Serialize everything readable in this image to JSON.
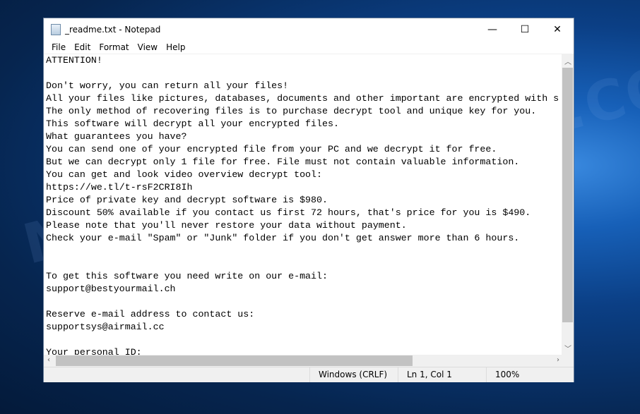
{
  "window": {
    "title": "_readme.txt - Notepad",
    "minimize": "—",
    "maximize": "☐",
    "close": "✕"
  },
  "menu": [
    "File",
    "Edit",
    "Format",
    "View",
    "Help"
  ],
  "text": "ATTENTION!\n\nDon't worry, you can return all your files!\nAll your files like pictures, databases, documents and other important are encrypted with s\nThe only method of recovering files is to purchase decrypt tool and unique key for you.\nThis software will decrypt all your encrypted files.\nWhat guarantees you have?\nYou can send one of your encrypted file from your PC and we decrypt it for free.\nBut we can decrypt only 1 file for free. File must not contain valuable information.\nYou can get and look video overview decrypt tool:\nhttps://we.tl/t-rsF2CRI8Ih\nPrice of private key and decrypt software is $980.\nDiscount 50% available if you contact us first 72 hours, that's price for you is $490.\nPlease note that you'll never restore your data without payment.\nCheck your e-mail \"Spam\" or \"Junk\" folder if you don't get answer more than 6 hours.\n\n\nTo get this software you need write on our e-mail:\nsupport@bestyourmail.ch\n\nReserve e-mail address to contact us:\nsupportsys@airmail.cc\n\nYour personal ID:",
  "status": {
    "line_ending": "Windows (CRLF)",
    "position": "Ln 1, Col 1",
    "zoom": "100%"
  },
  "watermark": "MYANTISPYWARE.COM"
}
